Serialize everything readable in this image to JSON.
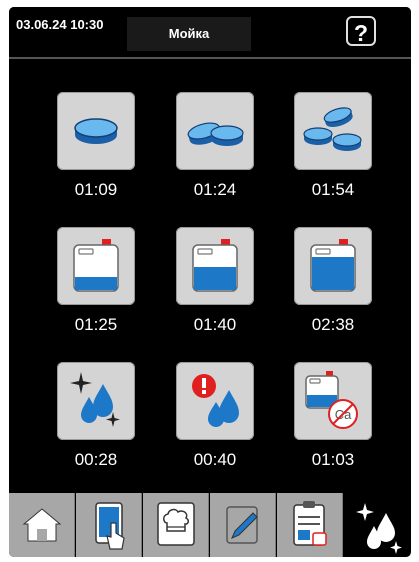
{
  "header": {
    "datetime": "03.06.24  10:30",
    "title": "Мойка",
    "help_icon": "help-icon",
    "help_label": "?"
  },
  "programs": [
    {
      "icon": "one-tablet-icon",
      "time": "01:09"
    },
    {
      "icon": "two-tablets-icon",
      "time": "01:24"
    },
    {
      "icon": "three-tablets-icon",
      "time": "01:54"
    },
    {
      "icon": "canister-low-level-icon",
      "time": "01:25"
    },
    {
      "icon": "canister-medium-level-icon",
      "time": "01:40"
    },
    {
      "icon": "canister-high-level-icon",
      "time": "02:38"
    },
    {
      "icon": "sparkle-drops-icon",
      "time": "00:28"
    },
    {
      "icon": "alert-drops-icon",
      "time": "00:40"
    },
    {
      "icon": "canister-no-calcium-icon",
      "time": "01:03"
    }
  ],
  "tabs": [
    {
      "icon": "home-icon"
    },
    {
      "icon": "touch-screen-icon"
    },
    {
      "icon": "chef-hat-icon"
    },
    {
      "icon": "edit-icon"
    },
    {
      "icon": "clipboard-icon"
    },
    {
      "icon": "cleaning-drops-icon",
      "active": true
    }
  ],
  "colors": {
    "background": "#000000",
    "tile": "#d4d4d4",
    "tab": "#a7a7a7",
    "accent_blue": "#1e78c8",
    "alert_red": "#e02020"
  }
}
